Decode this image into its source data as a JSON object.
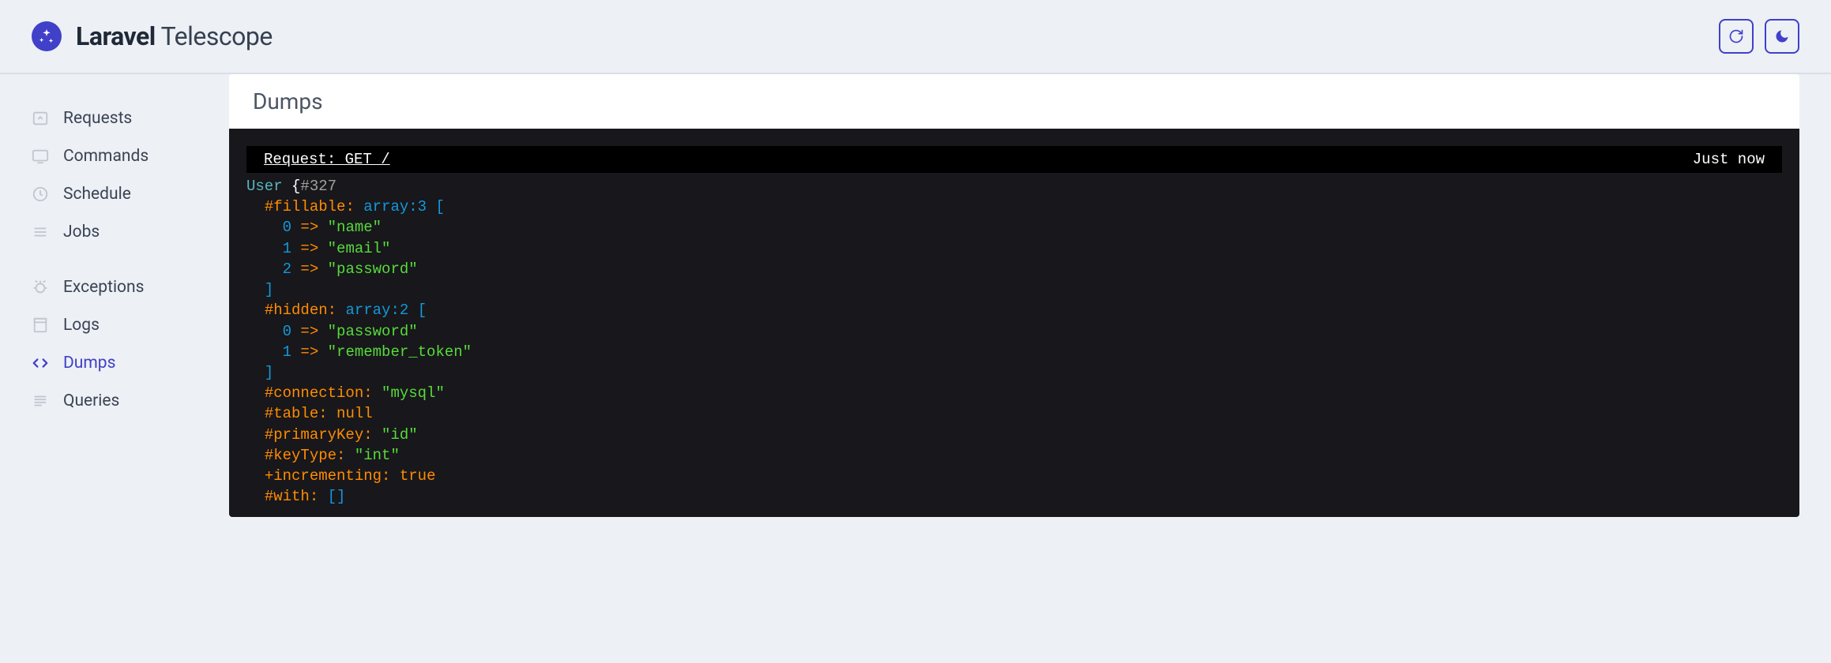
{
  "brand": {
    "strong": "Laravel",
    "light": "Telescope"
  },
  "sidebar": {
    "groups": [
      [
        {
          "label": "Requests",
          "icon": "requests-icon",
          "active": false
        },
        {
          "label": "Commands",
          "icon": "commands-icon",
          "active": false
        },
        {
          "label": "Schedule",
          "icon": "schedule-icon",
          "active": false
        },
        {
          "label": "Jobs",
          "icon": "jobs-icon",
          "active": false
        }
      ],
      [
        {
          "label": "Exceptions",
          "icon": "exceptions-icon",
          "active": false
        },
        {
          "label": "Logs",
          "icon": "logs-icon",
          "active": false
        },
        {
          "label": "Dumps",
          "icon": "dumps-icon",
          "active": true
        },
        {
          "label": "Queries",
          "icon": "queries-icon",
          "active": false
        }
      ]
    ]
  },
  "main": {
    "panel_title": "Dumps",
    "dump_header_link": "Request: GET /",
    "dump_header_time": "Just now",
    "dump": {
      "class_name": "User",
      "object_id": "#327",
      "fillable": {
        "count": 3,
        "items": [
          "name",
          "email",
          "password"
        ]
      },
      "hidden": {
        "count": 2,
        "items": [
          "password",
          "remember_token"
        ]
      },
      "connection": "mysql",
      "table": null,
      "primaryKey": "id",
      "keyType": "int",
      "incrementing": true,
      "with": []
    }
  }
}
